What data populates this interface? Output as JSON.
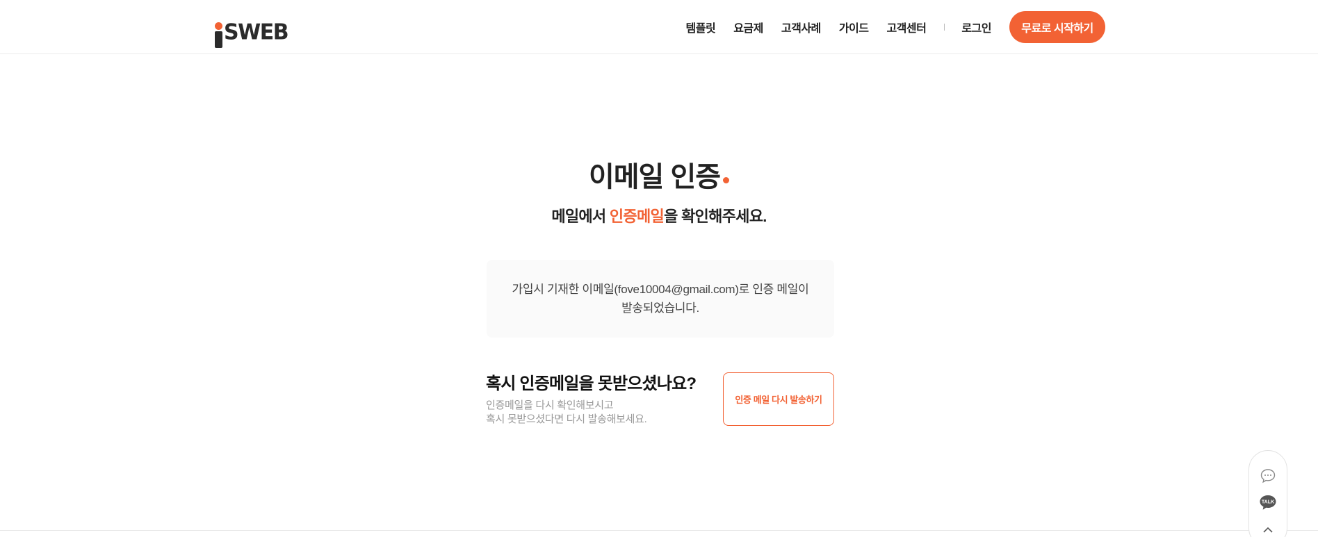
{
  "header": {
    "logo_text": "SWEB",
    "nav": [
      "템플릿",
      "요금제",
      "고객사례",
      "가이드",
      "고객센터"
    ],
    "login": "로그인",
    "cta": "무료로 시작하기"
  },
  "main": {
    "title": "이메일 인증",
    "subtitle_pre": "메일에서 ",
    "subtitle_accent": "인증메일",
    "subtitle_post": "을 확인해주세요.",
    "notice_line1": "가입시 기재한 이메일(fove10004@gmail.com)로 인증 메일이",
    "notice_line2": "발송되었습니다.",
    "resend_question": "혹시 인증메일을 못받으셨나요?",
    "resend_desc_line1": "인증메일을 다시 확인해보시고",
    "resend_desc_line2": "혹시 못받으셨다면 다시 발송해보세요.",
    "resend_button": "인증 메일 다시 발송하기"
  },
  "floating": {
    "talk_label": "TALK"
  },
  "colors": {
    "accent": "#f26234",
    "text": "#222222",
    "muted": "#999999",
    "box_bg": "#fafafa"
  },
  "icons": [
    "chat-bubble-icon",
    "kakao-talk-icon",
    "chevron-up-icon"
  ]
}
